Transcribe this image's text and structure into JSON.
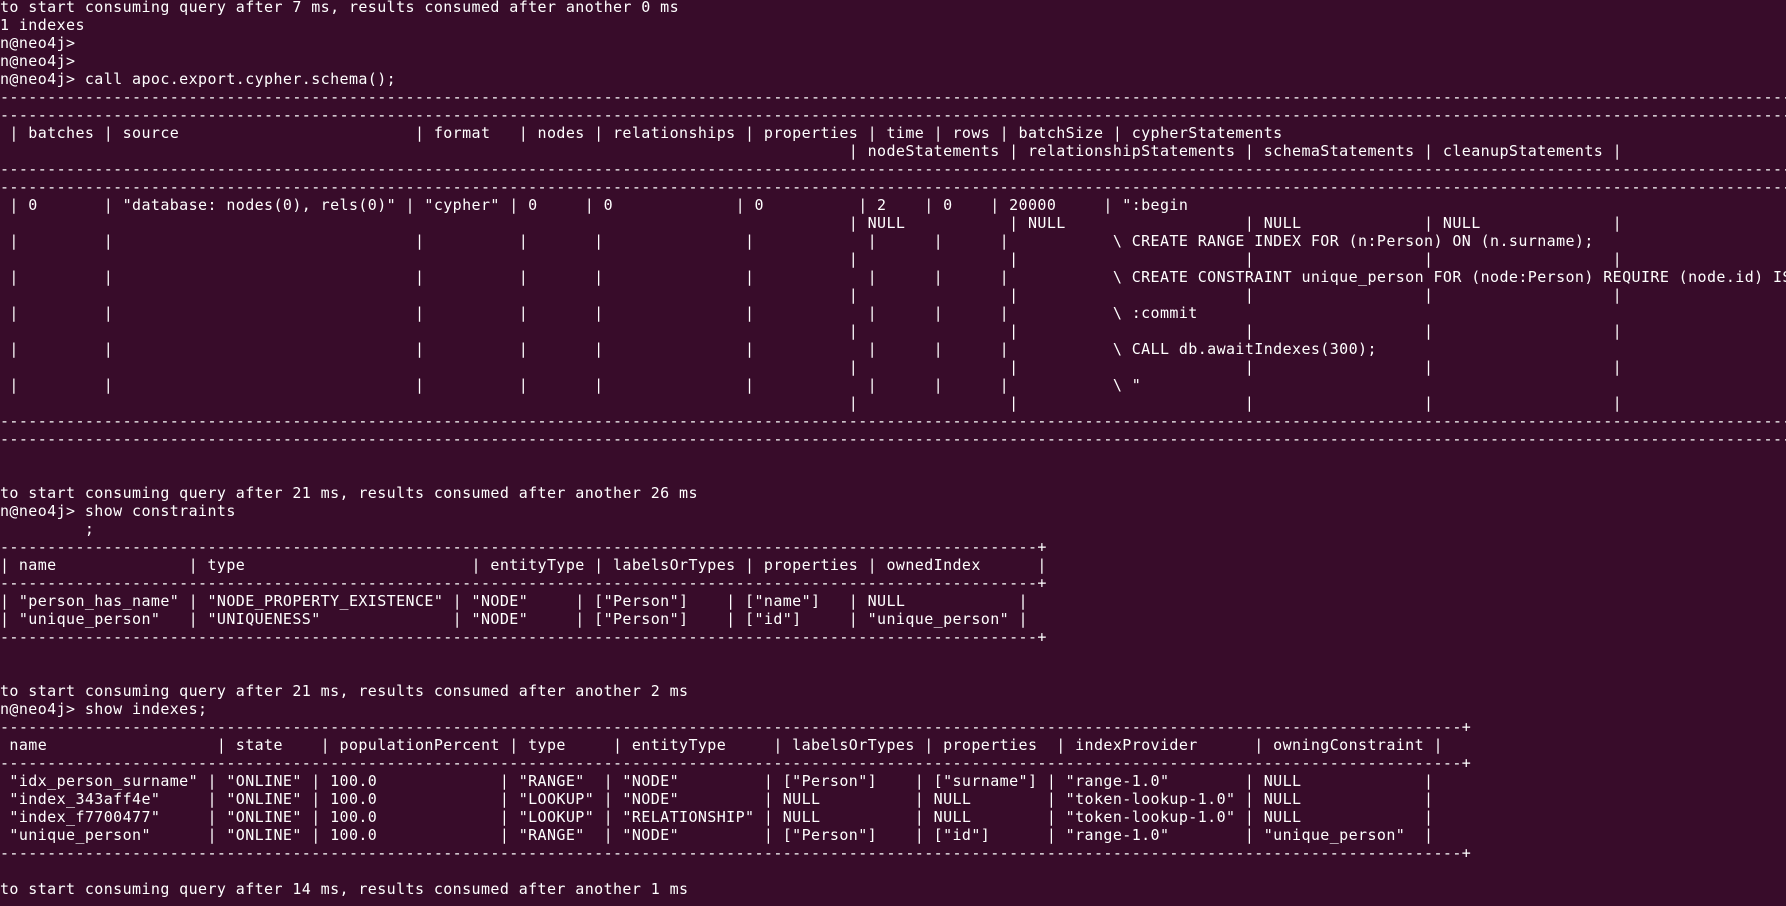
{
  "terminal": {
    "bg_color": "#380c2a",
    "fg_color": "#ffffff",
    "lines": [
      "to start consuming query after 7 ms, results consumed after another 0 ms",
      "1 indexes",
      "n@neo4j>",
      "n@neo4j>",
      "n@neo4j> call apoc.export.cypher.schema();",
      "------------------------------------------------------------------------------------------------------------------------------------------------------------------------------------------------------------------------------",
      "-------------------------------------------------------------------------------------------------------------------------------------------------------------------------------------------------+",
      " | batches | source                         | format   | nodes | relationships | properties | time | rows | batchSize | cypherStatements",
      "                                                                                          | nodeStatements | relationshipStatements | schemaStatements | cleanupStatements |",
      "------------------------------------------------------------------------------------------------------------------------------------------------------------------------------------------------------------------------------",
      "-------------------------------------------------------------------------------------------------------------------------------------------------------------------------------------------------+",
      " | 0       | \"database: nodes(0), rels(0)\" | \"cypher\" | 0     | 0             | 0          | 2    | 0    | 20000     | \":begin",
      "                                                                                          | NULL           | NULL                   | NULL             | NULL              |",
      " |         |                                |          |       |               |            |      |      |           \\ CREATE RANGE INDEX FOR (n:Person) ON (n.surname);",
      "                                                                                          |                |                        |                  |                   |",
      " |         |                                |          |       |               |            |      |      |           \\ CREATE CONSTRAINT unique_person FOR (node:Person) REQUIRE (node.id) IS UNIQUE;",
      "                                                                                          |                |                        |                  |                   |",
      " |         |                                |          |       |               |            |      |      |           \\ :commit",
      "                                                                                          |                |                        |                  |                   |",
      " |         |                                |          |       |               |            |      |      |           \\ CALL db.awaitIndexes(300);",
      "                                                                                          |                |                        |                  |                   |",
      " |         |                                |          |       |               |            |      |      |           \\ \"",
      "                                                                                          |                |                        |                  |                   |",
      "------------------------------------------------------------------------------------------------------------------------------------------------------------------------------------------------------------------------------",
      "-------------------------------------------------------------------------------------------------------------------------------------------------------------------------------------------------+",
      "",
      "",
      "to start consuming query after 21 ms, results consumed after another 26 ms",
      "n@neo4j> show constraints",
      "         ;",
      "--------------------------------------------------------------------------------------------------------------+",
      "| name              | type                        | entityType | labelsOrTypes | properties | ownedIndex      |",
      "--------------------------------------------------------------------------------------------------------------+",
      "| \"person_has_name\" | \"NODE_PROPERTY_EXISTENCE\" | \"NODE\"     | [\"Person\"]    | [\"name\"]   | NULL            |",
      "| \"unique_person\"   | \"UNIQUENESS\"              | \"NODE\"     | [\"Person\"]    | [\"id\"]     | \"unique_person\" |",
      "--------------------------------------------------------------------------------------------------------------+",
      "",
      "",
      "to start consuming query after 21 ms, results consumed after another 2 ms",
      "n@neo4j> show indexes;",
      "-----------------------------------------------------------------------------------------------------------------------------------------------------------+",
      " name                  | state    | populationPercent | type     | entityType     | labelsOrTypes | properties  | indexProvider      | owningConstraint |",
      "-----------------------------------------------------------------------------------------------------------------------------------------------------------+",
      " \"idx_person_surname\" | \"ONLINE\" | 100.0             | \"RANGE\"  | \"NODE\"         | [\"Person\"]    | [\"surname\"] | \"range-1.0\"        | NULL             |",
      " \"index_343aff4e\"     | \"ONLINE\" | 100.0             | \"LOOKUP\" | \"NODE\"         | NULL          | NULL        | \"token-lookup-1.0\" | NULL             |",
      " \"index_f7700477\"     | \"ONLINE\" | 100.0             | \"LOOKUP\" | \"RELATIONSHIP\" | NULL          | NULL        | \"token-lookup-1.0\" | NULL             |",
      " \"unique_person\"      | \"ONLINE\" | 100.0             | \"RANGE\"  | \"NODE\"         | [\"Person\"]    | [\"id\"]      | \"range-1.0\"        | \"unique_person\"  |",
      "-----------------------------------------------------------------------------------------------------------------------------------------------------------+",
      "",
      "to start consuming query after 14 ms, results consumed after another 1 ms"
    ]
  }
}
